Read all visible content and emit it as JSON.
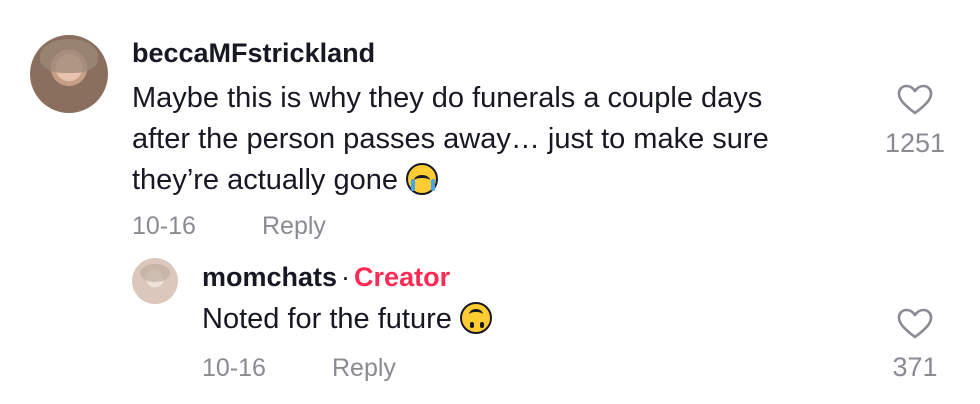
{
  "comment": {
    "username": "beccaMFstrickland",
    "lines": [
      "Maybe this is why they do funerals a couple days",
      "after the person passes away… just to make sure",
      "they’re actually gone"
    ],
    "emoji": "loudly-crying-face",
    "date": "10-16",
    "reply_label": "Reply",
    "like_count": "1251"
  },
  "reply": {
    "username": "momchats",
    "separator": "·",
    "badge": "Creator",
    "text": "Noted for the future",
    "emoji": "upside-down-face",
    "date": "10-16",
    "reply_label": "Reply",
    "like_count": "371"
  },
  "colors": {
    "text": "#161823",
    "muted": "#8a8b91",
    "creator": "#fe2c55"
  }
}
